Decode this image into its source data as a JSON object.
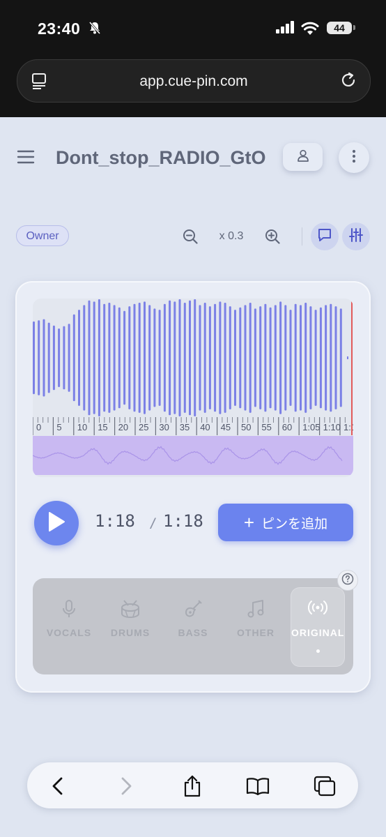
{
  "status_bar": {
    "time": "23:40",
    "battery": "44"
  },
  "browser": {
    "url": "app.cue-pin.com"
  },
  "header": {
    "title": "Dont_stop_RADIO_GtOr"
  },
  "toolbar": {
    "owner_badge": "Owner",
    "zoom_level": "x 0.3"
  },
  "waveform": {
    "ruler_labels": [
      "0",
      "5",
      "10",
      "15",
      "20",
      "25",
      "30",
      "35",
      "40",
      "45",
      "50",
      "55",
      "60",
      "1:05",
      "1:10",
      "1:1"
    ]
  },
  "player": {
    "current_time": "1:18",
    "separator": "/",
    "total_time": "1:18",
    "add_pin_label": "ピンを追加"
  },
  "stems": [
    {
      "label": "VOCALS",
      "icon": "microphone-icon"
    },
    {
      "label": "DRUMS",
      "icon": "drum-icon"
    },
    {
      "label": "BASS",
      "icon": "guitar-icon"
    },
    {
      "label": "OTHER",
      "icon": "music-note-icon"
    },
    {
      "label": "ORIGINAL",
      "icon": "broadcast-icon"
    }
  ],
  "colors": {
    "accent": "#6b83ee",
    "waveform": "#7b80e6",
    "overview": "#c9b9f2",
    "playhead": "#e35c5c"
  }
}
